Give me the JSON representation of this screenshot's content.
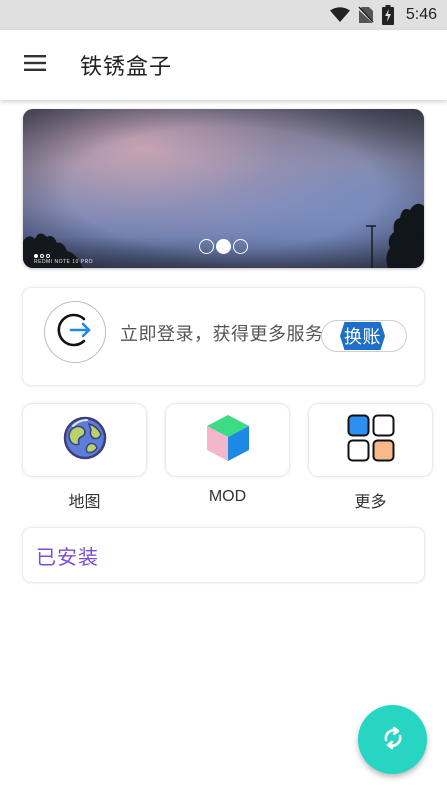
{
  "status_bar": {
    "time": "5:46",
    "icons": [
      "wifi-icon",
      "no-sim-icon",
      "battery-charging-icon"
    ]
  },
  "app_bar": {
    "menu_icon": "hamburger-menu-icon",
    "title": "铁锈盒子"
  },
  "banner": {
    "slide_count": 3,
    "active_slide_index": 1,
    "watermark": "REDMI NOTE 10 PRO"
  },
  "login": {
    "icon": "login-arrow-icon",
    "prompt": "立即登录，获得更多服务",
    "switch_account_label": "换账"
  },
  "features": [
    {
      "label": "地图",
      "icon": "globe-icon"
    },
    {
      "label": "MOD",
      "icon": "cube-icon"
    },
    {
      "label": "更多",
      "icon": "grid-icon"
    }
  ],
  "installed": {
    "label": "已安装"
  },
  "fab": {
    "icon": "refresh-icon"
  },
  "colors": {
    "accent_purple": "#7a4ed6",
    "fab_teal": "#26d6c3",
    "login_arrow_blue": "#1e88e5",
    "switch_label_blue": "#1e6fc9"
  }
}
